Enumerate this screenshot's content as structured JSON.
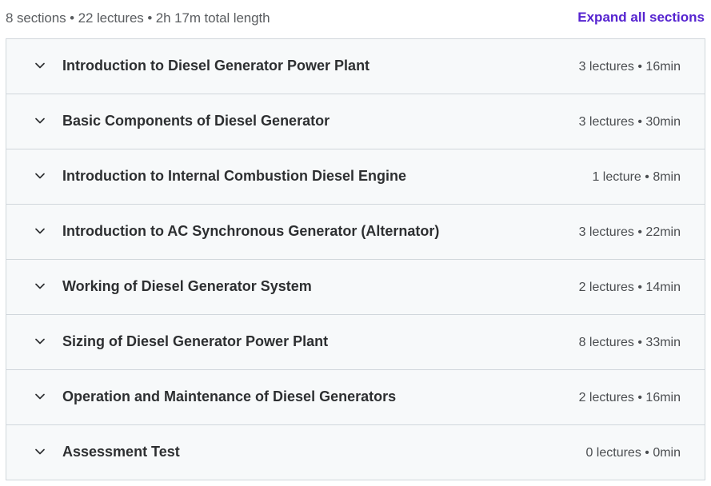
{
  "summary": {
    "text": "8 sections • 22 lectures • 2h 17m total length",
    "expand_label": "Expand all sections"
  },
  "colors": {
    "accent": "#5624d0",
    "row_background": "#f7f9fa",
    "border": "#d1d7dc",
    "text": "#2d2f31"
  },
  "icons": {
    "section_toggle": "chevron-down-icon"
  },
  "sections": [
    {
      "title": "Introduction to Diesel Generator Power Plant",
      "meta": "3 lectures • 16min"
    },
    {
      "title": "Basic Components of Diesel Generator",
      "meta": "3 lectures • 30min"
    },
    {
      "title": "Introduction to Internal Combustion Diesel Engine",
      "meta": "1 lecture • 8min"
    },
    {
      "title": "Introduction to AC Synchronous Generator (Alternator)",
      "meta": "3 lectures • 22min"
    },
    {
      "title": "Working of Diesel Generator System",
      "meta": "2 lectures • 14min"
    },
    {
      "title": "Sizing of Diesel Generator Power Plant",
      "meta": "8 lectures • 33min"
    },
    {
      "title": "Operation and Maintenance of Diesel Generators",
      "meta": "2 lectures • 16min"
    },
    {
      "title": "Assessment Test",
      "meta": "0 lectures • 0min"
    }
  ]
}
